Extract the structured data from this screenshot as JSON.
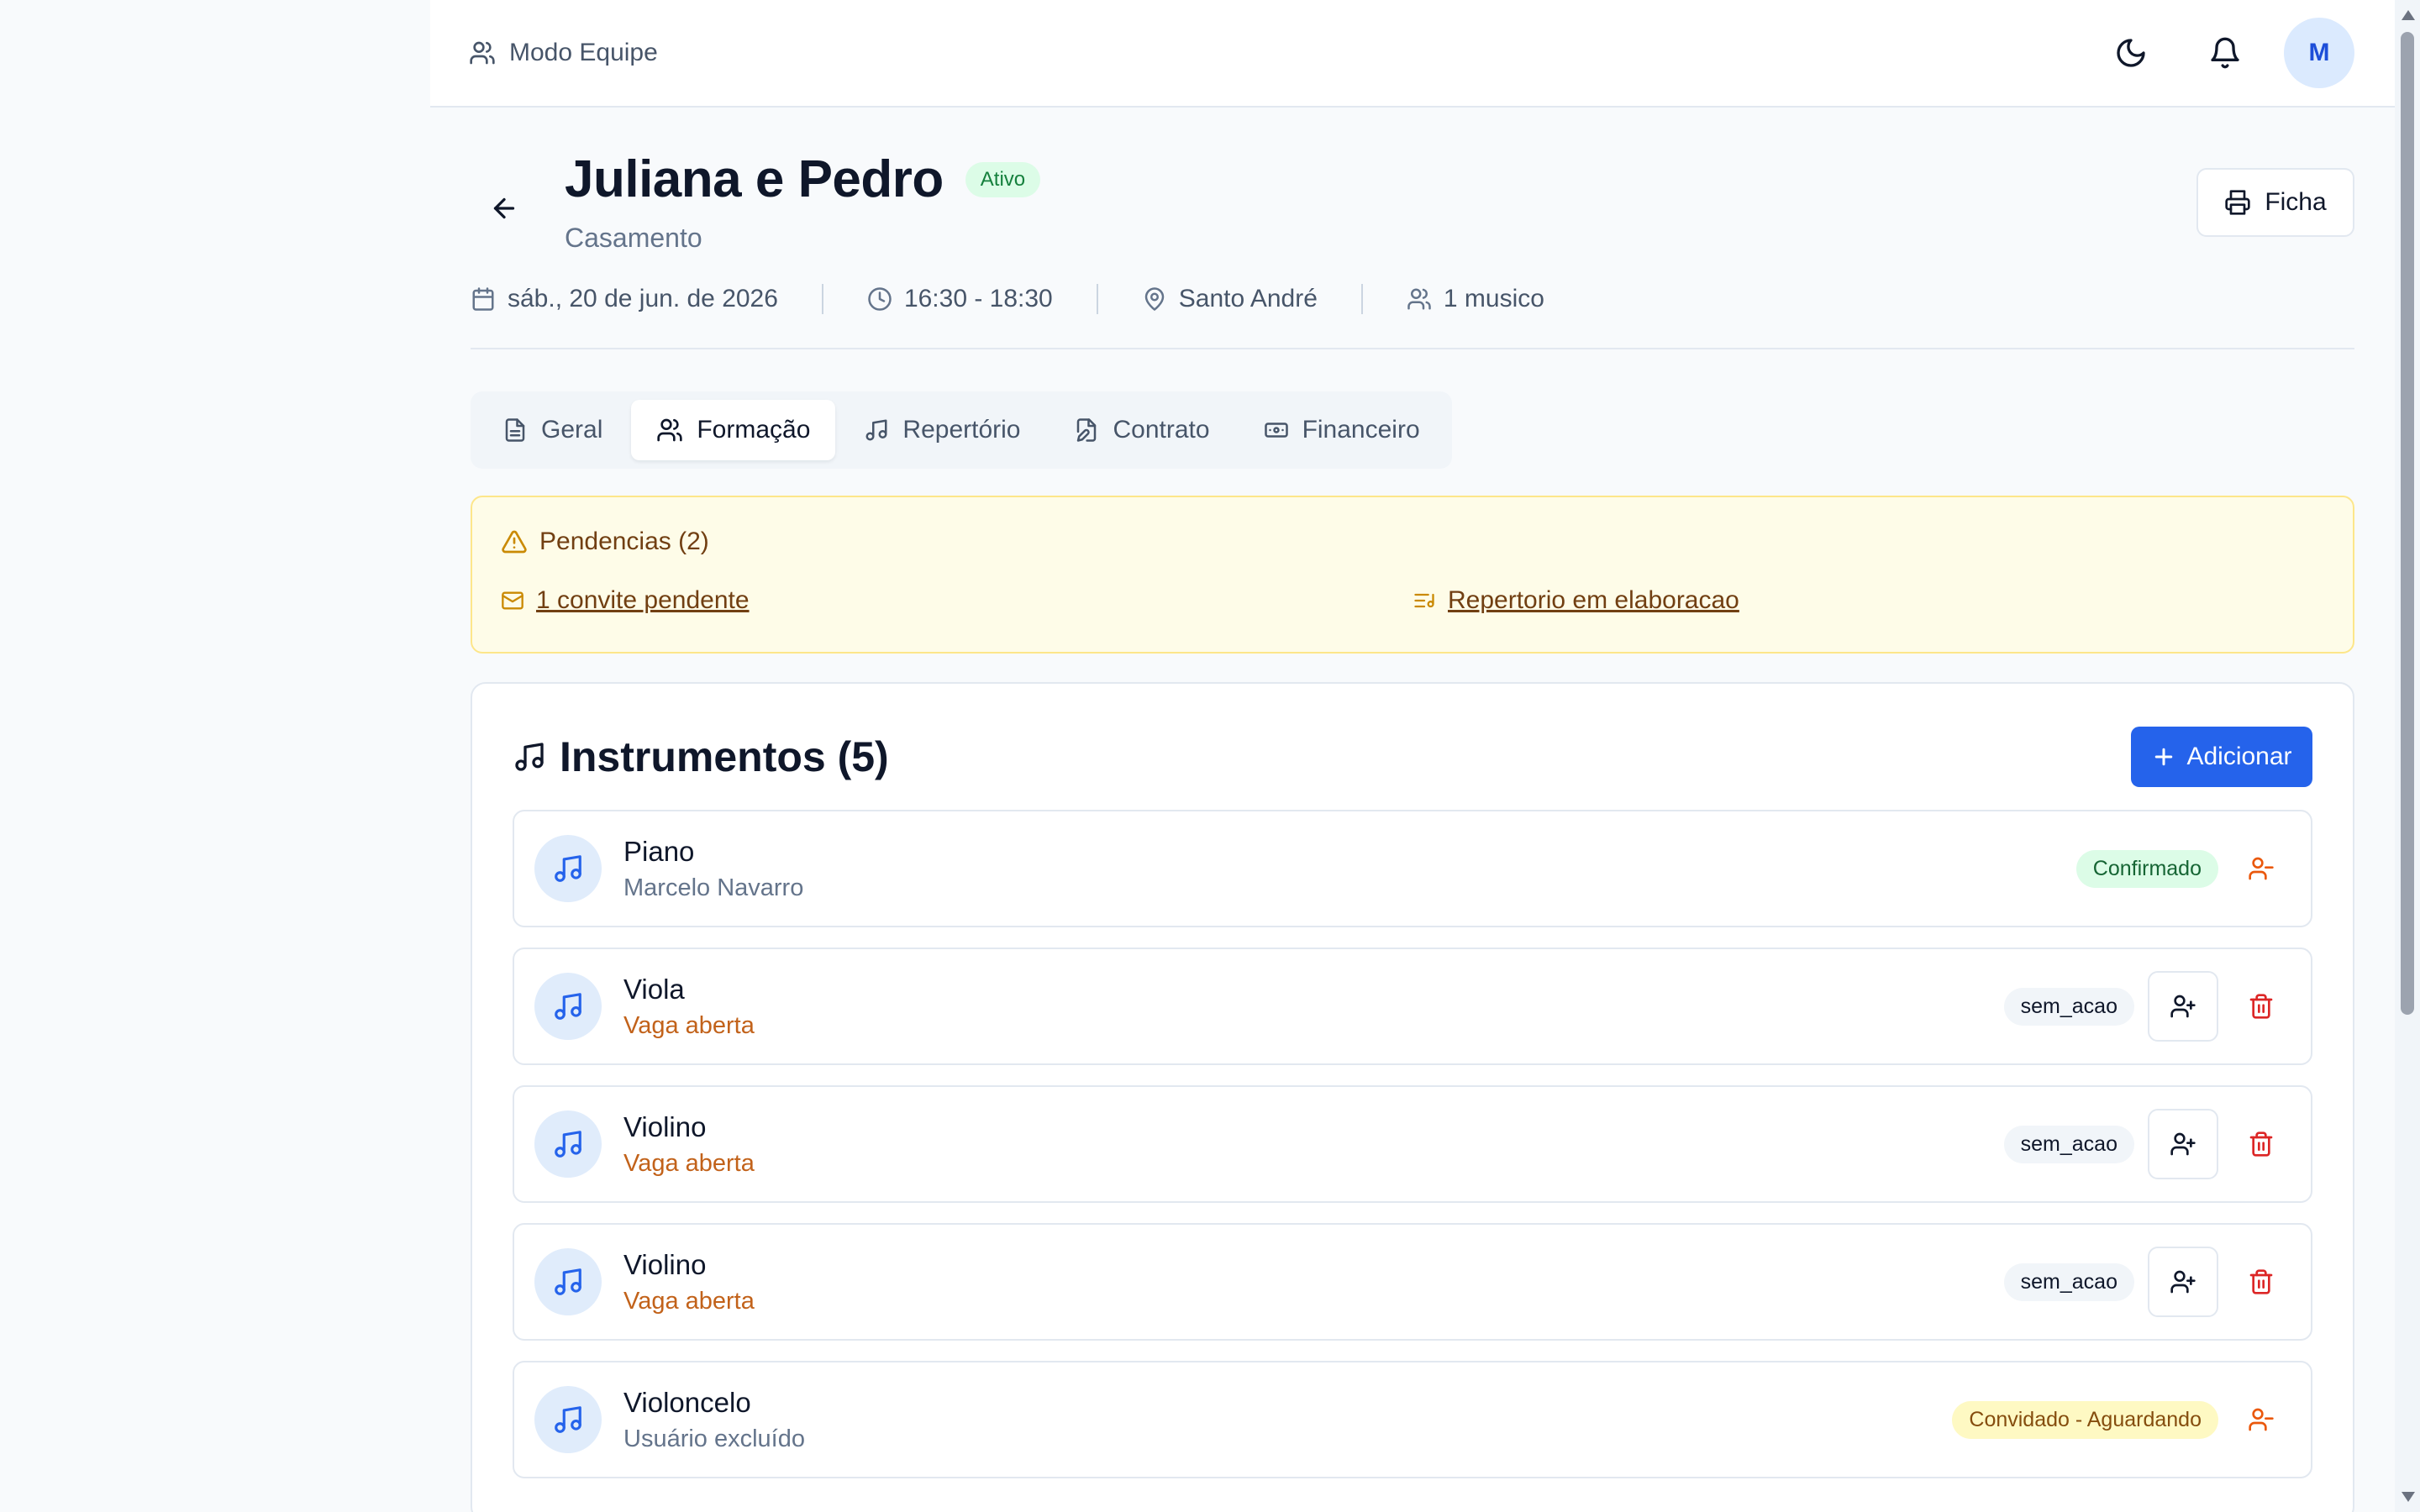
{
  "topbar": {
    "mode_label": "Modo Equipe",
    "avatar_initial": "M"
  },
  "event": {
    "title": "Juliana e Pedro",
    "status_badge": "Ativo",
    "subtitle": "Casamento",
    "ficha_label": "Ficha",
    "date": "sáb., 20 de jun. de 2026",
    "time": "16:30 - 18:30",
    "location": "Santo André",
    "musicians": "1 musico"
  },
  "tabs": [
    {
      "label": "Geral",
      "icon": "file-text-icon",
      "active": false
    },
    {
      "label": "Formação",
      "icon": "users-icon",
      "active": true
    },
    {
      "label": "Repertório",
      "icon": "music-icon",
      "active": false
    },
    {
      "label": "Contrato",
      "icon": "file-edit-icon",
      "active": false
    },
    {
      "label": "Financeiro",
      "icon": "banknote-icon",
      "active": false
    }
  ],
  "pendencias": {
    "title": "Pendencias (2)",
    "items": [
      {
        "label": "1 convite pendente",
        "icon": "mail-icon"
      },
      {
        "label": "Repertorio em elaboracao",
        "icon": "list-music-icon"
      }
    ]
  },
  "instruments": {
    "title": "Instrumentos (5)",
    "add_label": "Adicionar",
    "items": [
      {
        "name": "Piano",
        "sub": "Marcelo Navarro",
        "open": false,
        "status": "Confirmado",
        "status_color": "green",
        "actions": "remove"
      },
      {
        "name": "Viola",
        "sub": "Vaga aberta",
        "open": true,
        "status": "sem_acao",
        "status_color": "gray",
        "actions": "invite-delete"
      },
      {
        "name": "Violino",
        "sub": "Vaga aberta",
        "open": true,
        "status": "sem_acao",
        "status_color": "gray",
        "actions": "invite-delete"
      },
      {
        "name": "Violino",
        "sub": "Vaga aberta",
        "open": true,
        "status": "sem_acao",
        "status_color": "gray",
        "actions": "invite-delete"
      },
      {
        "name": "Violoncelo",
        "sub": "Usuário excluído",
        "open": false,
        "status": "Convidado - Aguardando",
        "status_color": "yellow",
        "actions": "remove"
      }
    ]
  },
  "colors": {
    "primary": "#2563eb",
    "success": "#16a34a",
    "warning_bg": "#fefce8",
    "danger": "#dc2626",
    "open_slot": "#c2621a"
  }
}
